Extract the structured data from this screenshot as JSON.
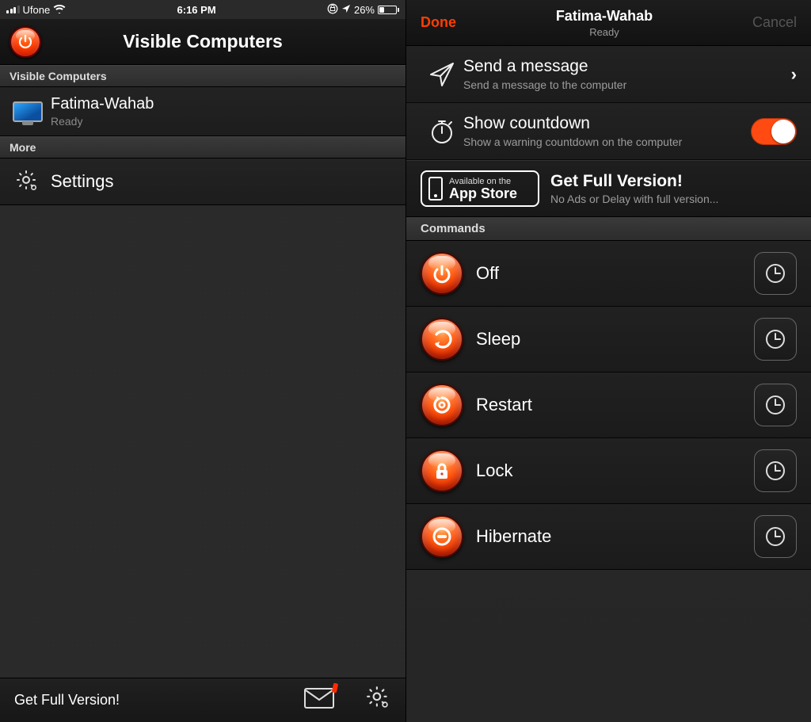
{
  "statusbar": {
    "carrier": "Ufone",
    "time": "6:16 PM",
    "battery_pct": "26%"
  },
  "left": {
    "nav_title": "Visible Computers",
    "section_computers": "Visible Computers",
    "section_more": "More",
    "computer": {
      "name": "Fatima-Wahab",
      "status": "Ready"
    },
    "settings_label": "Settings",
    "toolbar": {
      "get_full": "Get Full Version!"
    }
  },
  "right": {
    "done": "Done",
    "cancel": "Cancel",
    "title": "Fatima-Wahab",
    "subtitle": "Ready",
    "send_msg": {
      "title": "Send a message",
      "sub": "Send a message to the computer"
    },
    "countdown": {
      "title": "Show countdown",
      "sub": "Show a warning countdown on the computer",
      "on": true
    },
    "appstore": {
      "line1": "Available on the",
      "line2": "App Store"
    },
    "gfv": {
      "title": "Get Full Version!",
      "sub": "No Ads or Delay with full version..."
    },
    "commands_header": "Commands",
    "commands": [
      {
        "label": "Off",
        "icon": "power"
      },
      {
        "label": "Sleep",
        "icon": "sleep"
      },
      {
        "label": "Restart",
        "icon": "restart"
      },
      {
        "label": "Lock",
        "icon": "lock"
      },
      {
        "label": "Hibernate",
        "icon": "hibernate"
      }
    ]
  }
}
